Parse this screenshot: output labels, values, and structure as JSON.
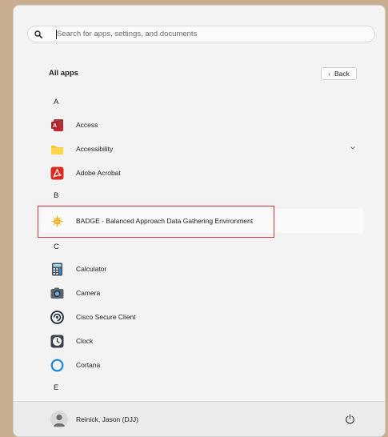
{
  "search": {
    "placeholder": "Search for apps, settings, and documents",
    "icon": "search-icon"
  },
  "all_apps": {
    "title": "All apps",
    "back_label": "Back"
  },
  "sections": [
    {
      "letter": "A",
      "apps": [
        {
          "label": "Access",
          "icon": "access-icon"
        },
        {
          "label": "Accessibility",
          "icon": "folder-icon",
          "expandable": true
        },
        {
          "label": "Adobe Acrobat",
          "icon": "adobe-acrobat-icon"
        }
      ]
    },
    {
      "letter": "B",
      "apps": [
        {
          "label": "BADGE - Balanced Approach Data Gathering Environment",
          "icon": "badge-sun-icon",
          "highlighted": true
        }
      ]
    },
    {
      "letter": "C",
      "apps": [
        {
          "label": "Calculator",
          "icon": "calculator-icon"
        },
        {
          "label": "Camera",
          "icon": "camera-icon"
        },
        {
          "label": "Cisco Secure Client",
          "icon": "cisco-secure-client-icon"
        },
        {
          "label": "Clock",
          "icon": "clock-icon"
        },
        {
          "label": "Cortana",
          "icon": "cortana-icon"
        }
      ]
    },
    {
      "letter": "E",
      "apps": []
    }
  ],
  "footer": {
    "user_name": "Reinick, Jason (DJJ)",
    "power_icon": "power-icon"
  },
  "colors": {
    "highlight_border": "#d9313a",
    "panel_background": "#f3f3f3",
    "wallpaper": "#c9ad8f"
  }
}
